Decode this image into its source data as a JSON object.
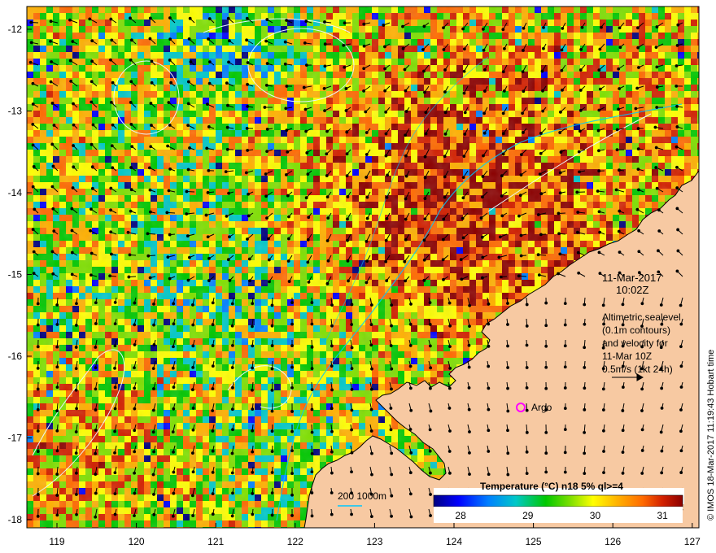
{
  "map": {
    "lon_ticks": [
      "119",
      "120",
      "121",
      "122",
      "123",
      "124",
      "125",
      "126",
      "127"
    ],
    "lat_ticks": [
      "-12",
      "-13",
      "-14",
      "-15",
      "-16",
      "-17",
      "-18"
    ],
    "datetime": {
      "date": "11-Mar-2017",
      "time": "10:02Z"
    },
    "altimetry_note": {
      "line1": "Altimetric sealevel",
      "line2": "(0.1m contours)",
      "line3": "and velocity for",
      "line4": "11-Mar 10Z",
      "line5": "0.5m/s (1kt 24h)"
    },
    "argo_label": "Argo",
    "depth_legend": "200  1000m",
    "colorbar": {
      "title": "Temperature (°C) n18 5% ql>=4",
      "ticks": [
        "28",
        "29",
        "30",
        "31"
      ],
      "range": [
        27.6,
        31.3
      ],
      "stops": [
        "#00007f",
        "#0000ff",
        "#0080ff",
        "#00c8c8",
        "#00c800",
        "#7fe000",
        "#ffff00",
        "#ffb000",
        "#ff6a00",
        "#d22000",
        "#8b0000"
      ]
    },
    "credit": "© IMOS 18-Mar-2017 11:19:43 Hobart time",
    "colors": {
      "land": "#f7c9a2",
      "coast": "#000000",
      "contour": "#d8f0ff",
      "isobath_200": "#00c8ff",
      "argo": "#ff00ff"
    }
  }
}
